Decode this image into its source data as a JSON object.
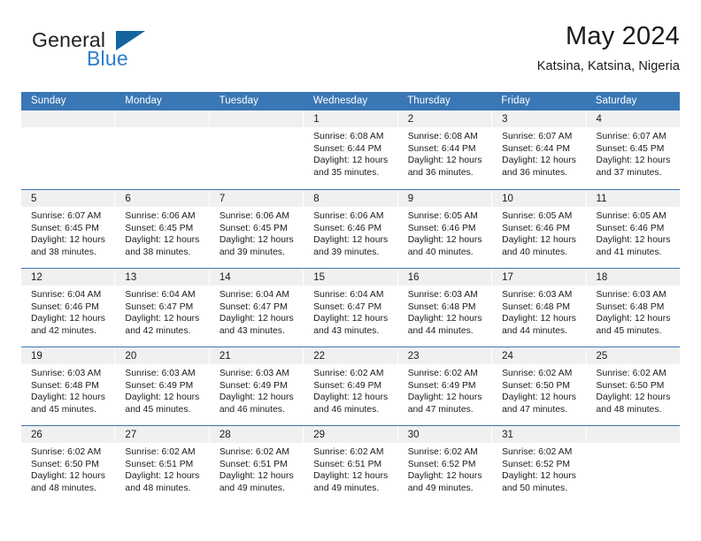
{
  "brand": {
    "name_part1": "General",
    "name_part2": "Blue",
    "triangle_icon": "triangle-icon",
    "colors": {
      "dark": "#231f20",
      "blue": "#2a7fc9",
      "triangle": "#12659f"
    }
  },
  "header": {
    "title": "May 2024",
    "subtitle": "Katsina, Katsina, Nigeria"
  },
  "theme": {
    "header_bar": "#3a77b5",
    "daynum_band": "#f0f0f0",
    "text": "#1a1a1a"
  },
  "weekdays": [
    "Sunday",
    "Monday",
    "Tuesday",
    "Wednesday",
    "Thursday",
    "Friday",
    "Saturday"
  ],
  "labels": {
    "sunrise_prefix": "Sunrise:",
    "sunset_prefix": "Sunset:",
    "daylight_prefix": "Daylight:"
  },
  "weeks": [
    [
      {
        "day": "",
        "empty": true,
        "sunrise": "",
        "sunset": "",
        "daylight_line1": "",
        "daylight_line2": ""
      },
      {
        "day": "",
        "empty": true,
        "sunrise": "",
        "sunset": "",
        "daylight_line1": "",
        "daylight_line2": ""
      },
      {
        "day": "",
        "empty": true,
        "sunrise": "",
        "sunset": "",
        "daylight_line1": "",
        "daylight_line2": ""
      },
      {
        "day": "1",
        "empty": false,
        "sunrise": "Sunrise: 6:08 AM",
        "sunset": "Sunset: 6:44 PM",
        "daylight_line1": "Daylight: 12 hours",
        "daylight_line2": "and 35 minutes."
      },
      {
        "day": "2",
        "empty": false,
        "sunrise": "Sunrise: 6:08 AM",
        "sunset": "Sunset: 6:44 PM",
        "daylight_line1": "Daylight: 12 hours",
        "daylight_line2": "and 36 minutes."
      },
      {
        "day": "3",
        "empty": false,
        "sunrise": "Sunrise: 6:07 AM",
        "sunset": "Sunset: 6:44 PM",
        "daylight_line1": "Daylight: 12 hours",
        "daylight_line2": "and 36 minutes."
      },
      {
        "day": "4",
        "empty": false,
        "sunrise": "Sunrise: 6:07 AM",
        "sunset": "Sunset: 6:45 PM",
        "daylight_line1": "Daylight: 12 hours",
        "daylight_line2": "and 37 minutes."
      }
    ],
    [
      {
        "day": "5",
        "empty": false,
        "sunrise": "Sunrise: 6:07 AM",
        "sunset": "Sunset: 6:45 PM",
        "daylight_line1": "Daylight: 12 hours",
        "daylight_line2": "and 38 minutes."
      },
      {
        "day": "6",
        "empty": false,
        "sunrise": "Sunrise: 6:06 AM",
        "sunset": "Sunset: 6:45 PM",
        "daylight_line1": "Daylight: 12 hours",
        "daylight_line2": "and 38 minutes."
      },
      {
        "day": "7",
        "empty": false,
        "sunrise": "Sunrise: 6:06 AM",
        "sunset": "Sunset: 6:45 PM",
        "daylight_line1": "Daylight: 12 hours",
        "daylight_line2": "and 39 minutes."
      },
      {
        "day": "8",
        "empty": false,
        "sunrise": "Sunrise: 6:06 AM",
        "sunset": "Sunset: 6:46 PM",
        "daylight_line1": "Daylight: 12 hours",
        "daylight_line2": "and 39 minutes."
      },
      {
        "day": "9",
        "empty": false,
        "sunrise": "Sunrise: 6:05 AM",
        "sunset": "Sunset: 6:46 PM",
        "daylight_line1": "Daylight: 12 hours",
        "daylight_line2": "and 40 minutes."
      },
      {
        "day": "10",
        "empty": false,
        "sunrise": "Sunrise: 6:05 AM",
        "sunset": "Sunset: 6:46 PM",
        "daylight_line1": "Daylight: 12 hours",
        "daylight_line2": "and 40 minutes."
      },
      {
        "day": "11",
        "empty": false,
        "sunrise": "Sunrise: 6:05 AM",
        "sunset": "Sunset: 6:46 PM",
        "daylight_line1": "Daylight: 12 hours",
        "daylight_line2": "and 41 minutes."
      }
    ],
    [
      {
        "day": "12",
        "empty": false,
        "sunrise": "Sunrise: 6:04 AM",
        "sunset": "Sunset: 6:46 PM",
        "daylight_line1": "Daylight: 12 hours",
        "daylight_line2": "and 42 minutes."
      },
      {
        "day": "13",
        "empty": false,
        "sunrise": "Sunrise: 6:04 AM",
        "sunset": "Sunset: 6:47 PM",
        "daylight_line1": "Daylight: 12 hours",
        "daylight_line2": "and 42 minutes."
      },
      {
        "day": "14",
        "empty": false,
        "sunrise": "Sunrise: 6:04 AM",
        "sunset": "Sunset: 6:47 PM",
        "daylight_line1": "Daylight: 12 hours",
        "daylight_line2": "and 43 minutes."
      },
      {
        "day": "15",
        "empty": false,
        "sunrise": "Sunrise: 6:04 AM",
        "sunset": "Sunset: 6:47 PM",
        "daylight_line1": "Daylight: 12 hours",
        "daylight_line2": "and 43 minutes."
      },
      {
        "day": "16",
        "empty": false,
        "sunrise": "Sunrise: 6:03 AM",
        "sunset": "Sunset: 6:48 PM",
        "daylight_line1": "Daylight: 12 hours",
        "daylight_line2": "and 44 minutes."
      },
      {
        "day": "17",
        "empty": false,
        "sunrise": "Sunrise: 6:03 AM",
        "sunset": "Sunset: 6:48 PM",
        "daylight_line1": "Daylight: 12 hours",
        "daylight_line2": "and 44 minutes."
      },
      {
        "day": "18",
        "empty": false,
        "sunrise": "Sunrise: 6:03 AM",
        "sunset": "Sunset: 6:48 PM",
        "daylight_line1": "Daylight: 12 hours",
        "daylight_line2": "and 45 minutes."
      }
    ],
    [
      {
        "day": "19",
        "empty": false,
        "sunrise": "Sunrise: 6:03 AM",
        "sunset": "Sunset: 6:48 PM",
        "daylight_line1": "Daylight: 12 hours",
        "daylight_line2": "and 45 minutes."
      },
      {
        "day": "20",
        "empty": false,
        "sunrise": "Sunrise: 6:03 AM",
        "sunset": "Sunset: 6:49 PM",
        "daylight_line1": "Daylight: 12 hours",
        "daylight_line2": "and 45 minutes."
      },
      {
        "day": "21",
        "empty": false,
        "sunrise": "Sunrise: 6:03 AM",
        "sunset": "Sunset: 6:49 PM",
        "daylight_line1": "Daylight: 12 hours",
        "daylight_line2": "and 46 minutes."
      },
      {
        "day": "22",
        "empty": false,
        "sunrise": "Sunrise: 6:02 AM",
        "sunset": "Sunset: 6:49 PM",
        "daylight_line1": "Daylight: 12 hours",
        "daylight_line2": "and 46 minutes."
      },
      {
        "day": "23",
        "empty": false,
        "sunrise": "Sunrise: 6:02 AM",
        "sunset": "Sunset: 6:49 PM",
        "daylight_line1": "Daylight: 12 hours",
        "daylight_line2": "and 47 minutes."
      },
      {
        "day": "24",
        "empty": false,
        "sunrise": "Sunrise: 6:02 AM",
        "sunset": "Sunset: 6:50 PM",
        "daylight_line1": "Daylight: 12 hours",
        "daylight_line2": "and 47 minutes."
      },
      {
        "day": "25",
        "empty": false,
        "sunrise": "Sunrise: 6:02 AM",
        "sunset": "Sunset: 6:50 PM",
        "daylight_line1": "Daylight: 12 hours",
        "daylight_line2": "and 48 minutes."
      }
    ],
    [
      {
        "day": "26",
        "empty": false,
        "sunrise": "Sunrise: 6:02 AM",
        "sunset": "Sunset: 6:50 PM",
        "daylight_line1": "Daylight: 12 hours",
        "daylight_line2": "and 48 minutes."
      },
      {
        "day": "27",
        "empty": false,
        "sunrise": "Sunrise: 6:02 AM",
        "sunset": "Sunset: 6:51 PM",
        "daylight_line1": "Daylight: 12 hours",
        "daylight_line2": "and 48 minutes."
      },
      {
        "day": "28",
        "empty": false,
        "sunrise": "Sunrise: 6:02 AM",
        "sunset": "Sunset: 6:51 PM",
        "daylight_line1": "Daylight: 12 hours",
        "daylight_line2": "and 49 minutes."
      },
      {
        "day": "29",
        "empty": false,
        "sunrise": "Sunrise: 6:02 AM",
        "sunset": "Sunset: 6:51 PM",
        "daylight_line1": "Daylight: 12 hours",
        "daylight_line2": "and 49 minutes."
      },
      {
        "day": "30",
        "empty": false,
        "sunrise": "Sunrise: 6:02 AM",
        "sunset": "Sunset: 6:52 PM",
        "daylight_line1": "Daylight: 12 hours",
        "daylight_line2": "and 49 minutes."
      },
      {
        "day": "31",
        "empty": false,
        "sunrise": "Sunrise: 6:02 AM",
        "sunset": "Sunset: 6:52 PM",
        "daylight_line1": "Daylight: 12 hours",
        "daylight_line2": "and 50 minutes."
      },
      {
        "day": "",
        "empty": true,
        "sunrise": "",
        "sunset": "",
        "daylight_line1": "",
        "daylight_line2": ""
      }
    ]
  ]
}
